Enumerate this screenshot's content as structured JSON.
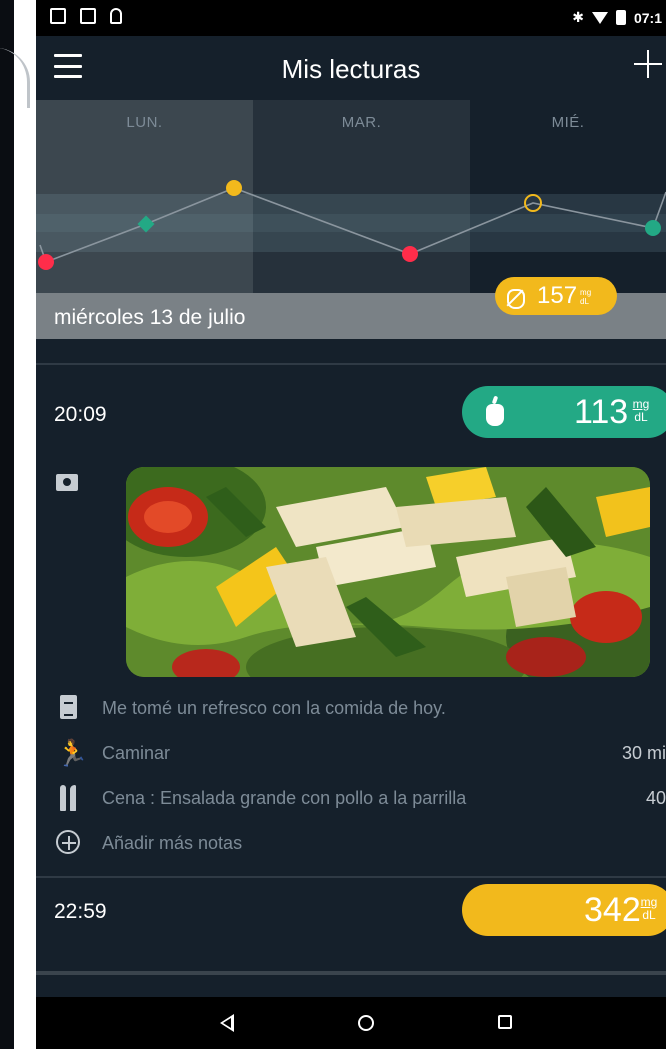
{
  "status_bar": {
    "time": "07:1"
  },
  "app_bar": {
    "title": "Mis lecturas"
  },
  "chart_data": {
    "type": "line",
    "categories": [
      "LUN.",
      "MAR.",
      "MIÉ."
    ],
    "colors": {
      "red": "#ff2d4a",
      "green": "#23a985",
      "yellow": "#f2b91c"
    },
    "highlighted_reading": {
      "value": "157",
      "unit_top": "mg",
      "unit_bottom": "dL",
      "icon": "no-apple-icon"
    }
  },
  "date_header": "miércoles 13 de julio",
  "readings": [
    {
      "time": "20:09",
      "value": "113",
      "unit_top": "mg",
      "unit_bottom": "dL",
      "badge_color": "#23a985",
      "icon": "apple-icon",
      "photo": "salad-with-grilled-chicken",
      "notes": {
        "text": "Me tomé un refresco con la comida de hoy.",
        "activity": {
          "label": "Caminar",
          "amount": "30 mi"
        },
        "meal": {
          "label": "Cena : Ensalada grande con pollo a la parrilla",
          "amount": "40"
        },
        "add_more": "Añadir más notas"
      }
    },
    {
      "time": "22:59",
      "value": "342",
      "unit_top": "mg",
      "unit_bottom": "dL",
      "badge_color": "#f2b91c"
    }
  ]
}
